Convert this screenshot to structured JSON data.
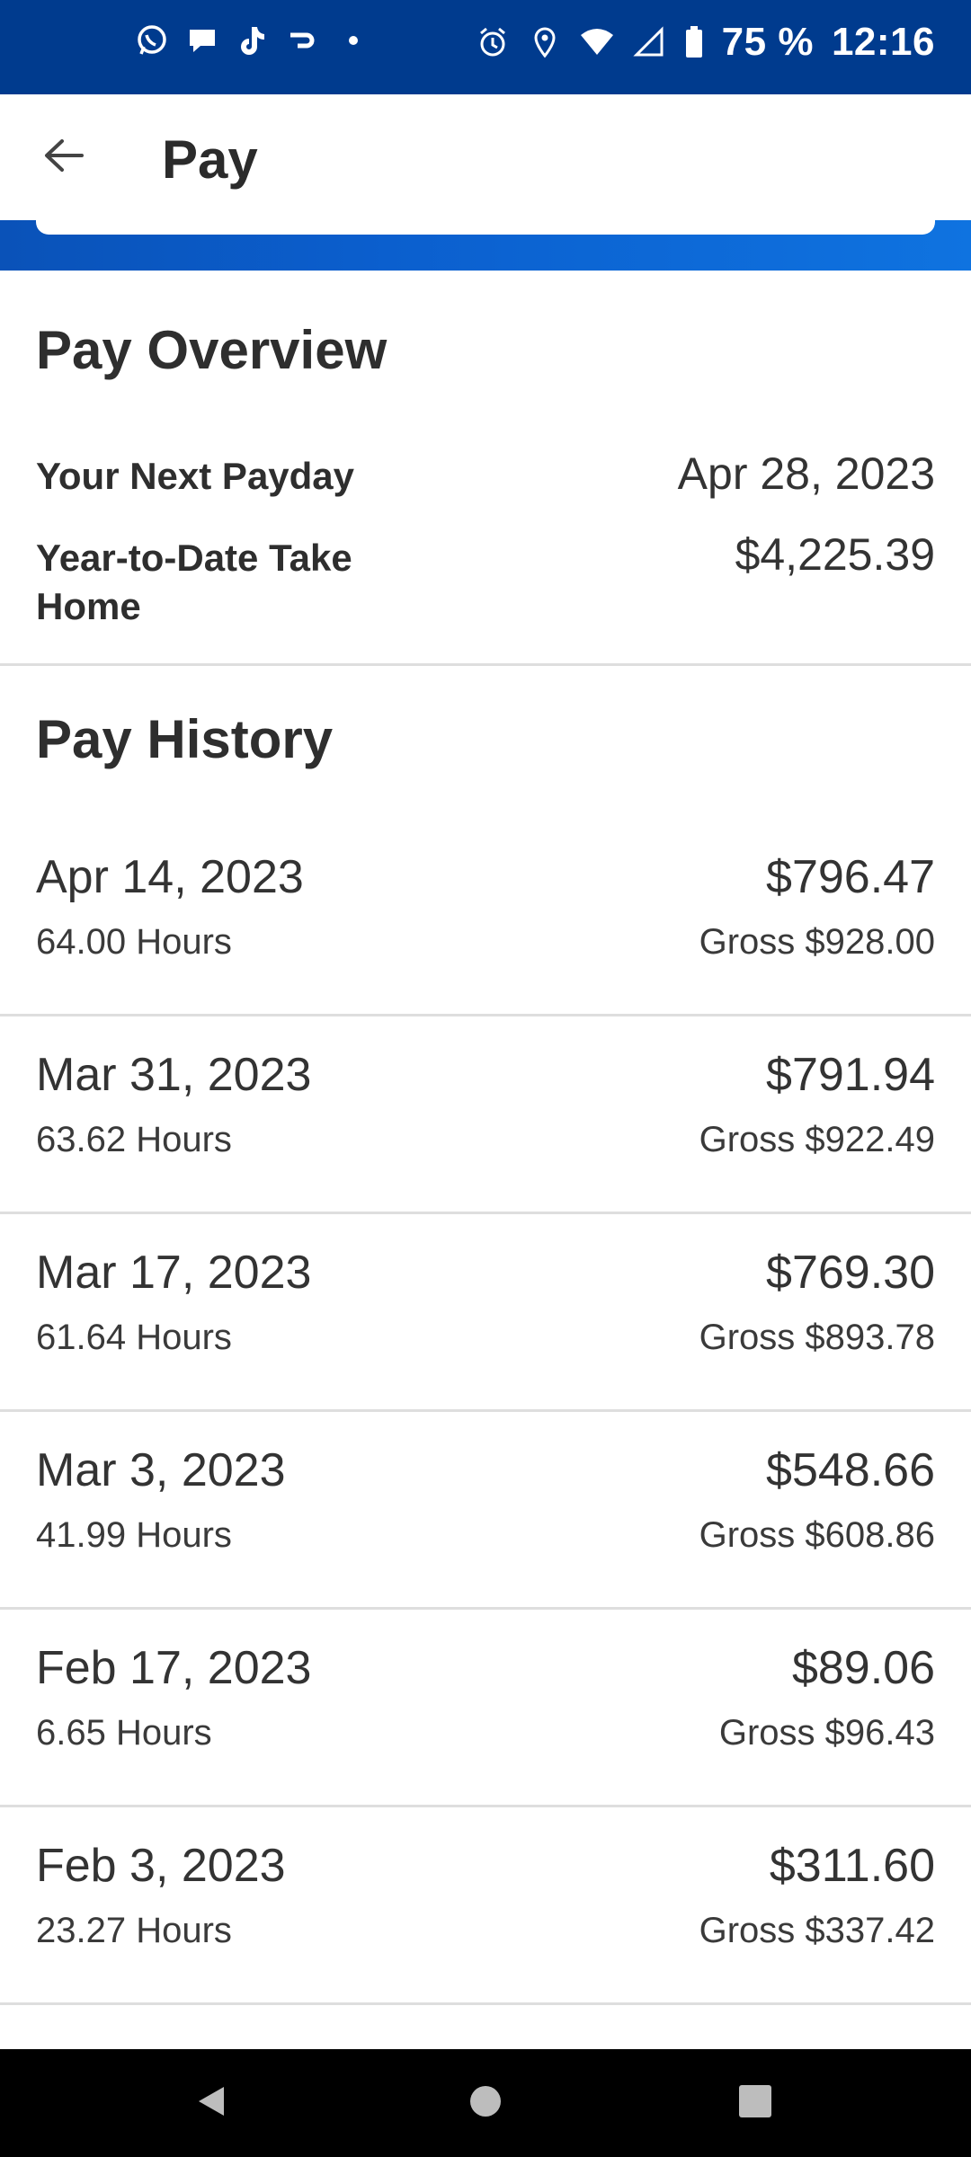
{
  "status_bar": {
    "battery": "75 %",
    "time": "12:16",
    "left_icons": [
      "whatsapp-icon",
      "chat-icon",
      "tiktok-icon",
      "hook-icon",
      "dot-icon"
    ],
    "right_icons": [
      "alarm-icon",
      "location-icon",
      "wifi-icon",
      "signal-icon",
      "battery-icon"
    ]
  },
  "app_bar": {
    "title": "Pay"
  },
  "overview": {
    "title": "Pay Overview",
    "next_payday_label": "Your Next Payday",
    "next_payday_value": "Apr 28, 2023",
    "ytd_label": "Year-to-Date Take Home",
    "ytd_value": "$4,225.39"
  },
  "history": {
    "title": "Pay History",
    "items": [
      {
        "date": "Apr 14, 2023",
        "hours": "64.00 Hours",
        "net": "$796.47",
        "gross": "Gross $928.00"
      },
      {
        "date": "Mar 31, 2023",
        "hours": "63.62 Hours",
        "net": "$791.94",
        "gross": "Gross $922.49"
      },
      {
        "date": "Mar 17, 2023",
        "hours": "61.64 Hours",
        "net": "$769.30",
        "gross": "Gross $893.78"
      },
      {
        "date": "Mar 3, 2023",
        "hours": "41.99 Hours",
        "net": "$548.66",
        "gross": "Gross $608.86"
      },
      {
        "date": "Feb 17, 2023",
        "hours": "6.65 Hours",
        "net": "$89.06",
        "gross": "Gross $96.43"
      },
      {
        "date": "Feb 3, 2023",
        "hours": "23.27 Hours",
        "net": "$311.60",
        "gross": "Gross $337.42"
      }
    ]
  },
  "colors": {
    "status_bar": "#003b8e",
    "accent_blue": "#0b5fce",
    "text": "#2e2e2e",
    "divider": "#dedede"
  }
}
